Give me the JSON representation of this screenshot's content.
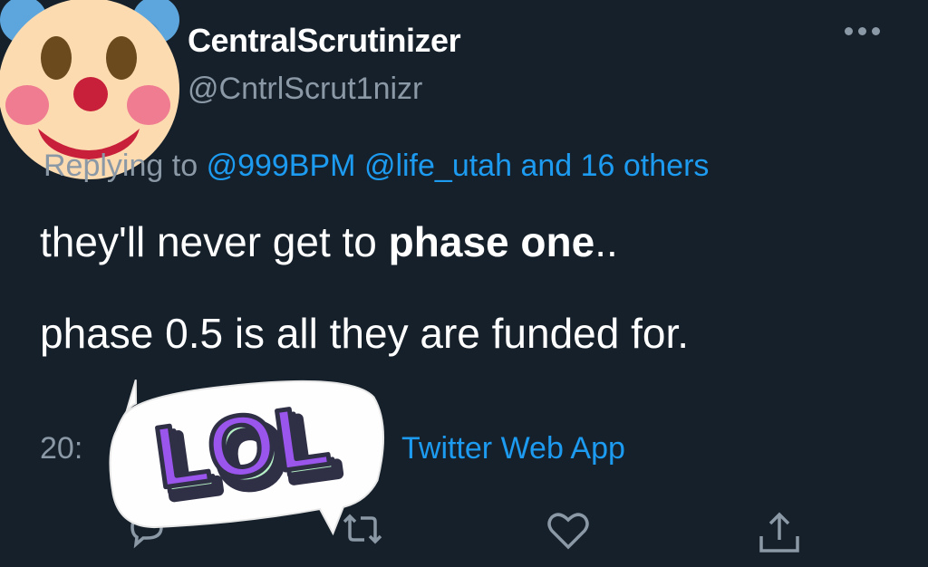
{
  "author": {
    "display_name": "CentralScrutinizer",
    "handle": "@CntrlScrut1nizr",
    "avatar_icon": "clown-face-emoji-icon"
  },
  "more_icon": "more-options-icon",
  "reply_context": {
    "prefix": "Replying to",
    "mentions": [
      "@999BPM",
      "@life_utah"
    ],
    "others": "and 16 others"
  },
  "tweet": {
    "line1_normal": "they'll never get to ",
    "line1_bold": "phase one",
    "line1_tail": "..",
    "line2": "phase 0.5 is all they are funded for."
  },
  "meta": {
    "time_partial": "20:",
    "source": "Twitter Web App"
  },
  "sticker": {
    "text": "LOL",
    "icon": "lol-speech-bubble-sticker"
  },
  "actions": [
    "reply-icon",
    "retweet-icon",
    "like-icon",
    "share-icon"
  ],
  "colors": {
    "background": "#15202b",
    "text": "#ffffff",
    "secondary": "#8b98a5",
    "link": "#1d9bf0"
  }
}
